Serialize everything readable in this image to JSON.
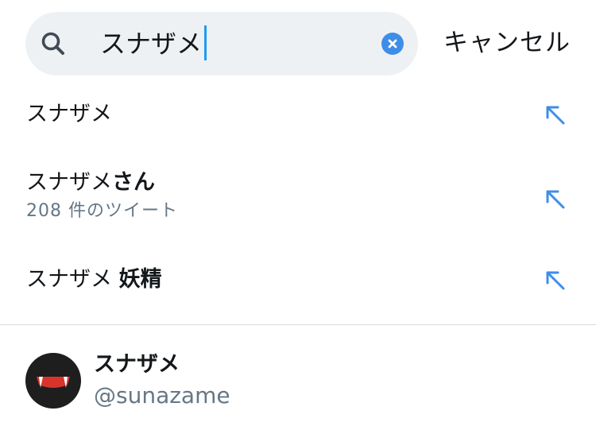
{
  "search": {
    "value": "スナザメ"
  },
  "cancel_label": "キャンセル",
  "suggestions": [
    {
      "prefix": "スナザメ",
      "bold": "",
      "sub": ""
    },
    {
      "prefix": "スナザメ",
      "bold": "さん",
      "sub": "208 件のツイート"
    },
    {
      "prefix": "スナザメ ",
      "bold": "妖精",
      "sub": ""
    }
  ],
  "user": {
    "name": "スナザメ",
    "handle": "@sunazame"
  },
  "colors": {
    "accent": "#3e8ee8",
    "search_bg": "#eef1f3",
    "secondary_text": "#657786"
  },
  "icons": {
    "search": "search-icon",
    "clear": "clear-icon",
    "suggestion": "arrow-up-left-icon"
  }
}
